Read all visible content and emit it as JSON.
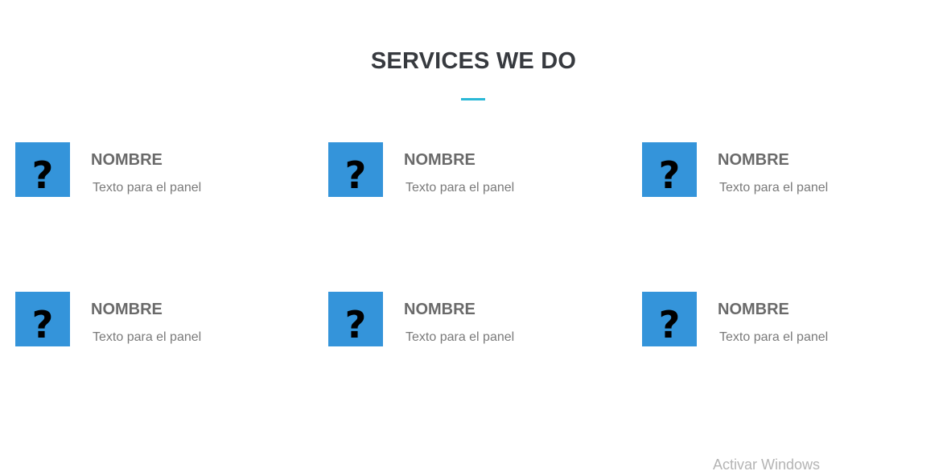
{
  "section": {
    "title": "SERVICES WE DO",
    "accent_color": "#2ab8d6",
    "icon_color": "#3494da"
  },
  "services": [
    {
      "icon": "question-mark-icon",
      "icon_glyph": "?",
      "name": "NOMBRE",
      "text": "Texto para el panel"
    },
    {
      "icon": "question-mark-icon",
      "icon_glyph": "?",
      "name": "NOMBRE",
      "text": "Texto para el panel"
    },
    {
      "icon": "question-mark-icon",
      "icon_glyph": "?",
      "name": "NOMBRE",
      "text": "Texto para el panel"
    },
    {
      "icon": "question-mark-icon",
      "icon_glyph": "?",
      "name": "NOMBRE",
      "text": "Texto para el panel"
    },
    {
      "icon": "question-mark-icon",
      "icon_glyph": "?",
      "name": "NOMBRE",
      "text": "Texto para el panel"
    },
    {
      "icon": "question-mark-icon",
      "icon_glyph": "?",
      "name": "NOMBRE",
      "text": "Texto para el panel"
    }
  ],
  "watermark": {
    "text": "Activar Windows"
  }
}
